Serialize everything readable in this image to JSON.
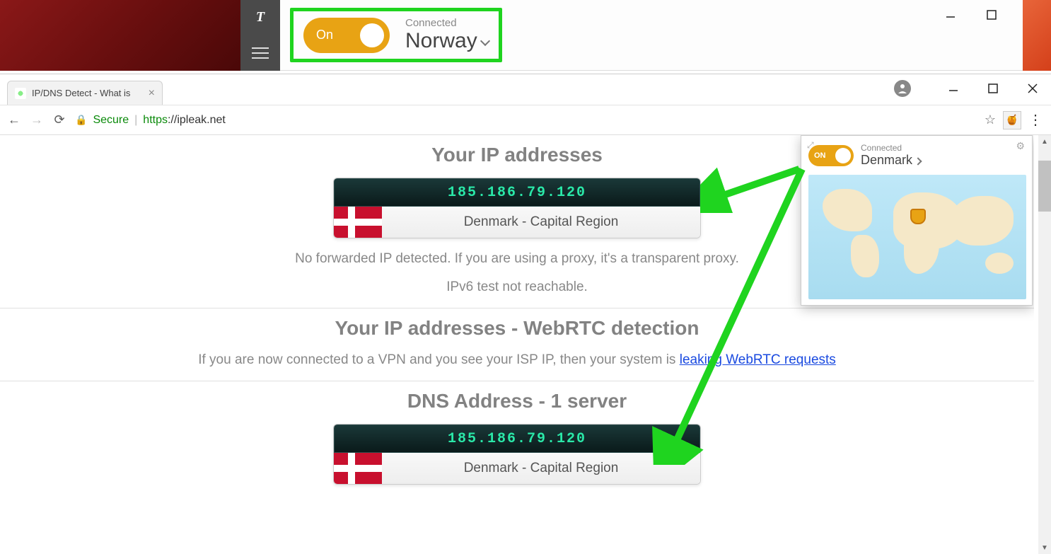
{
  "vpn_app": {
    "logo_letter": "T",
    "toggle_label": "On",
    "status_label": "Connected",
    "country": "Norway"
  },
  "browser": {
    "tab_title": "IP/DNS Detect - What is",
    "secure_label": "Secure",
    "url_scheme": "https",
    "url_host": "://ipleak.net",
    "account_icon": "●"
  },
  "page": {
    "h_ip": "Your IP addresses",
    "ip1_value": "185.186.79.120",
    "ip1_location": "Denmark - Capital Region",
    "forward_text": "No forwarded IP detected. If you are using a proxy, it's a transparent proxy.",
    "ipv6_text": "IPv6 test not reachable.",
    "h_webrtc": "Your IP addresses - WebRTC detection",
    "webrtc_text_pre": "If you are now connected to a VPN and you see your ISP IP, then your system is ",
    "webrtc_link": "leaking WebRTC requests",
    "h_dns": "DNS Address - 1 server",
    "dns_value": "185.186.79.120",
    "dns_location": "Denmark - Capital Region"
  },
  "ext_popup": {
    "toggle_label": "ON",
    "status_label": "Connected",
    "country": "Denmark"
  }
}
